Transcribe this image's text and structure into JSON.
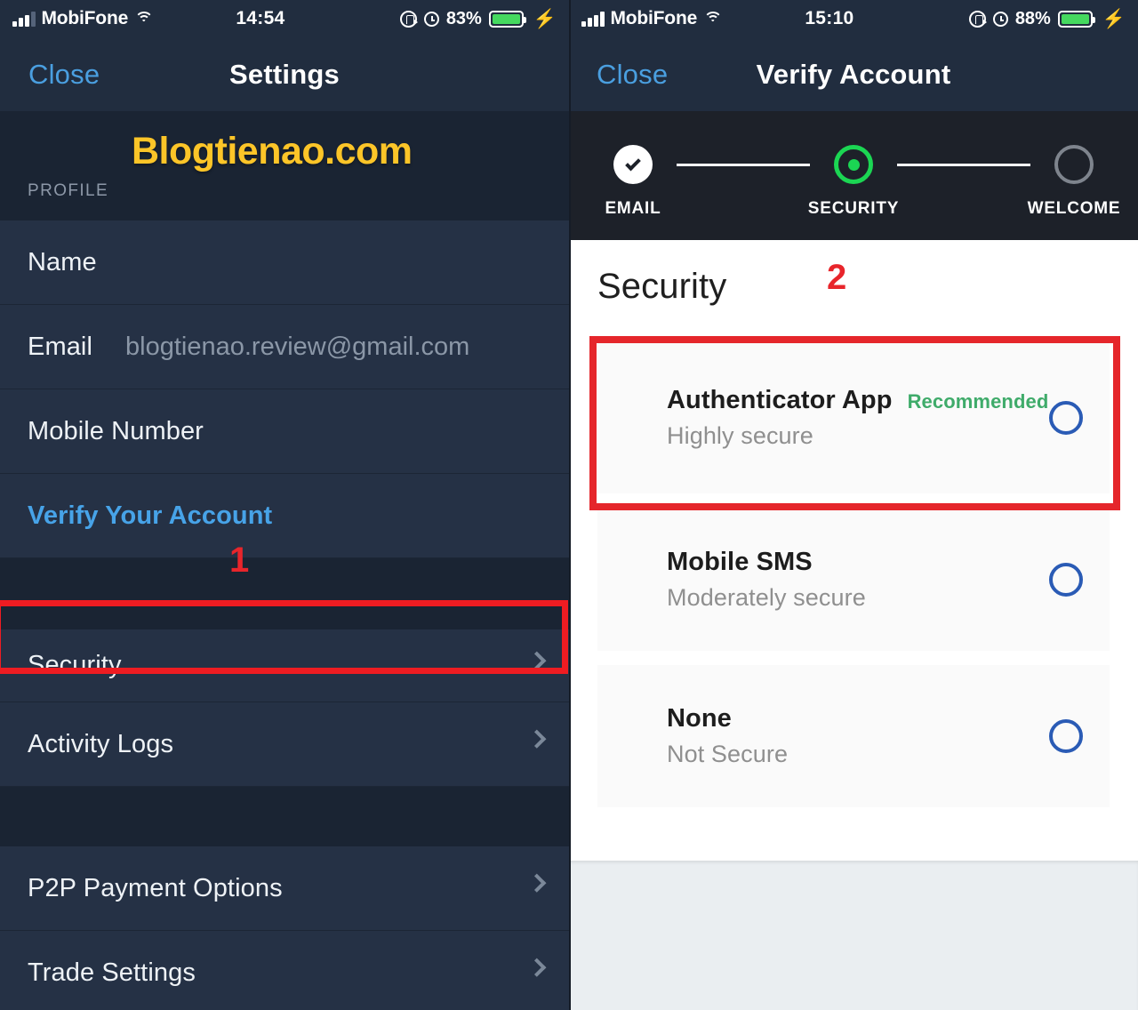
{
  "left": {
    "status_bar": {
      "carrier": "MobiFone",
      "time": "14:54",
      "battery_pct": "83%",
      "icons": [
        "signal-bars-icon",
        "wifi-icon",
        "rotation-lock-icon",
        "alarm-clock-icon",
        "battery-icon",
        "charging-bolt-icon"
      ]
    },
    "nav": {
      "close_label": "Close",
      "title": "Settings"
    },
    "watermark": "Blogtienao.com",
    "section_label": "PROFILE",
    "rows": [
      {
        "label": "Name",
        "value": "",
        "chevron": false,
        "link": false
      },
      {
        "label": "Email",
        "value": "blogtienao.review@gmail.com",
        "chevron": false,
        "link": false
      },
      {
        "label": "Mobile Number",
        "value": "",
        "chevron": false,
        "link": false
      },
      {
        "label": "Verify Your Account",
        "value": "",
        "chevron": false,
        "link": true
      }
    ],
    "rows_group2": [
      {
        "label": "Security",
        "chevron": true
      },
      {
        "label": "Activity Logs",
        "chevron": true
      }
    ],
    "rows_group3": [
      {
        "label": "P2P Payment Options",
        "chevron": true
      },
      {
        "label": "Trade Settings",
        "chevron": true
      }
    ],
    "annotation_marker": "1"
  },
  "right": {
    "status_bar": {
      "carrier": "MobiFone",
      "time": "15:10",
      "battery_pct": "88%",
      "icons": [
        "signal-bars-icon",
        "wifi-icon",
        "rotation-lock-icon",
        "alarm-clock-icon",
        "battery-icon",
        "charging-bolt-icon"
      ]
    },
    "nav": {
      "close_label": "Close",
      "title": "Verify Account"
    },
    "stepper": {
      "steps": [
        {
          "label": "EMAIL",
          "state": "done"
        },
        {
          "label": "SECURITY",
          "state": "active"
        },
        {
          "label": "WELCOME",
          "state": "todo"
        }
      ]
    },
    "section_title": "Security",
    "annotation_marker": "2",
    "options": [
      {
        "title": "Authenticator App",
        "badge": "Recommended",
        "subtitle": "Highly secure",
        "selected": false
      },
      {
        "title": "Mobile SMS",
        "badge": "",
        "subtitle": "Moderately secure",
        "selected": false
      },
      {
        "title": "None",
        "badge": "",
        "subtitle": "Not Secure",
        "selected": false
      }
    ]
  },
  "colors": {
    "nav_bg": "#212d3f",
    "row_bg": "#253145",
    "section_bg": "#1a2433",
    "link_blue": "#47a3e8",
    "watermark_yellow": "#fcc528",
    "annotation_red": "#e8252b",
    "stepper_green": "#1bd653",
    "badge_green": "#3fab6a",
    "radio_blue": "#2a5bb5",
    "battery_green": "#45d95f"
  }
}
